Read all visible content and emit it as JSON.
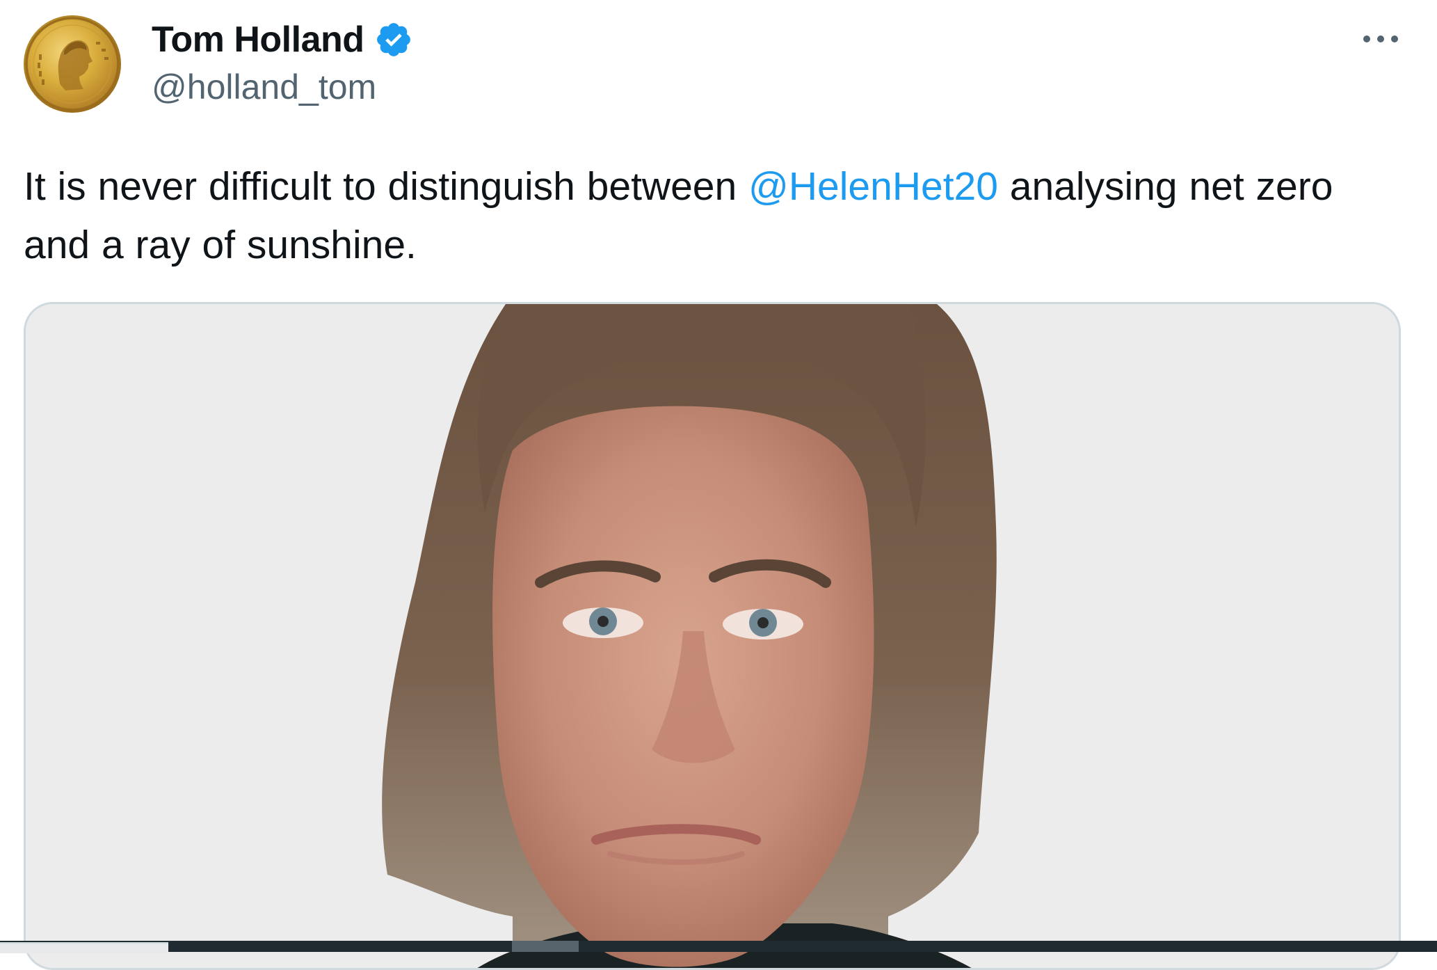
{
  "author": {
    "display_name": "Tom Holland",
    "handle": "@holland_tom",
    "avatar_icon": "roman-coin-avatar",
    "verified_icon": "verified-badge-icon",
    "verified_color": "#1d9bf0"
  },
  "tweet": {
    "text_before": "It is never difficult to distinguish between ",
    "mention": "@HelenHet20",
    "text_after": " analysing net zero and a ray of sunshine.",
    "mention_color": "#1d9bf0"
  },
  "more_menu_icon": "more-horizontal-icon",
  "media": {
    "type": "photo",
    "background_color": "#ececec"
  }
}
